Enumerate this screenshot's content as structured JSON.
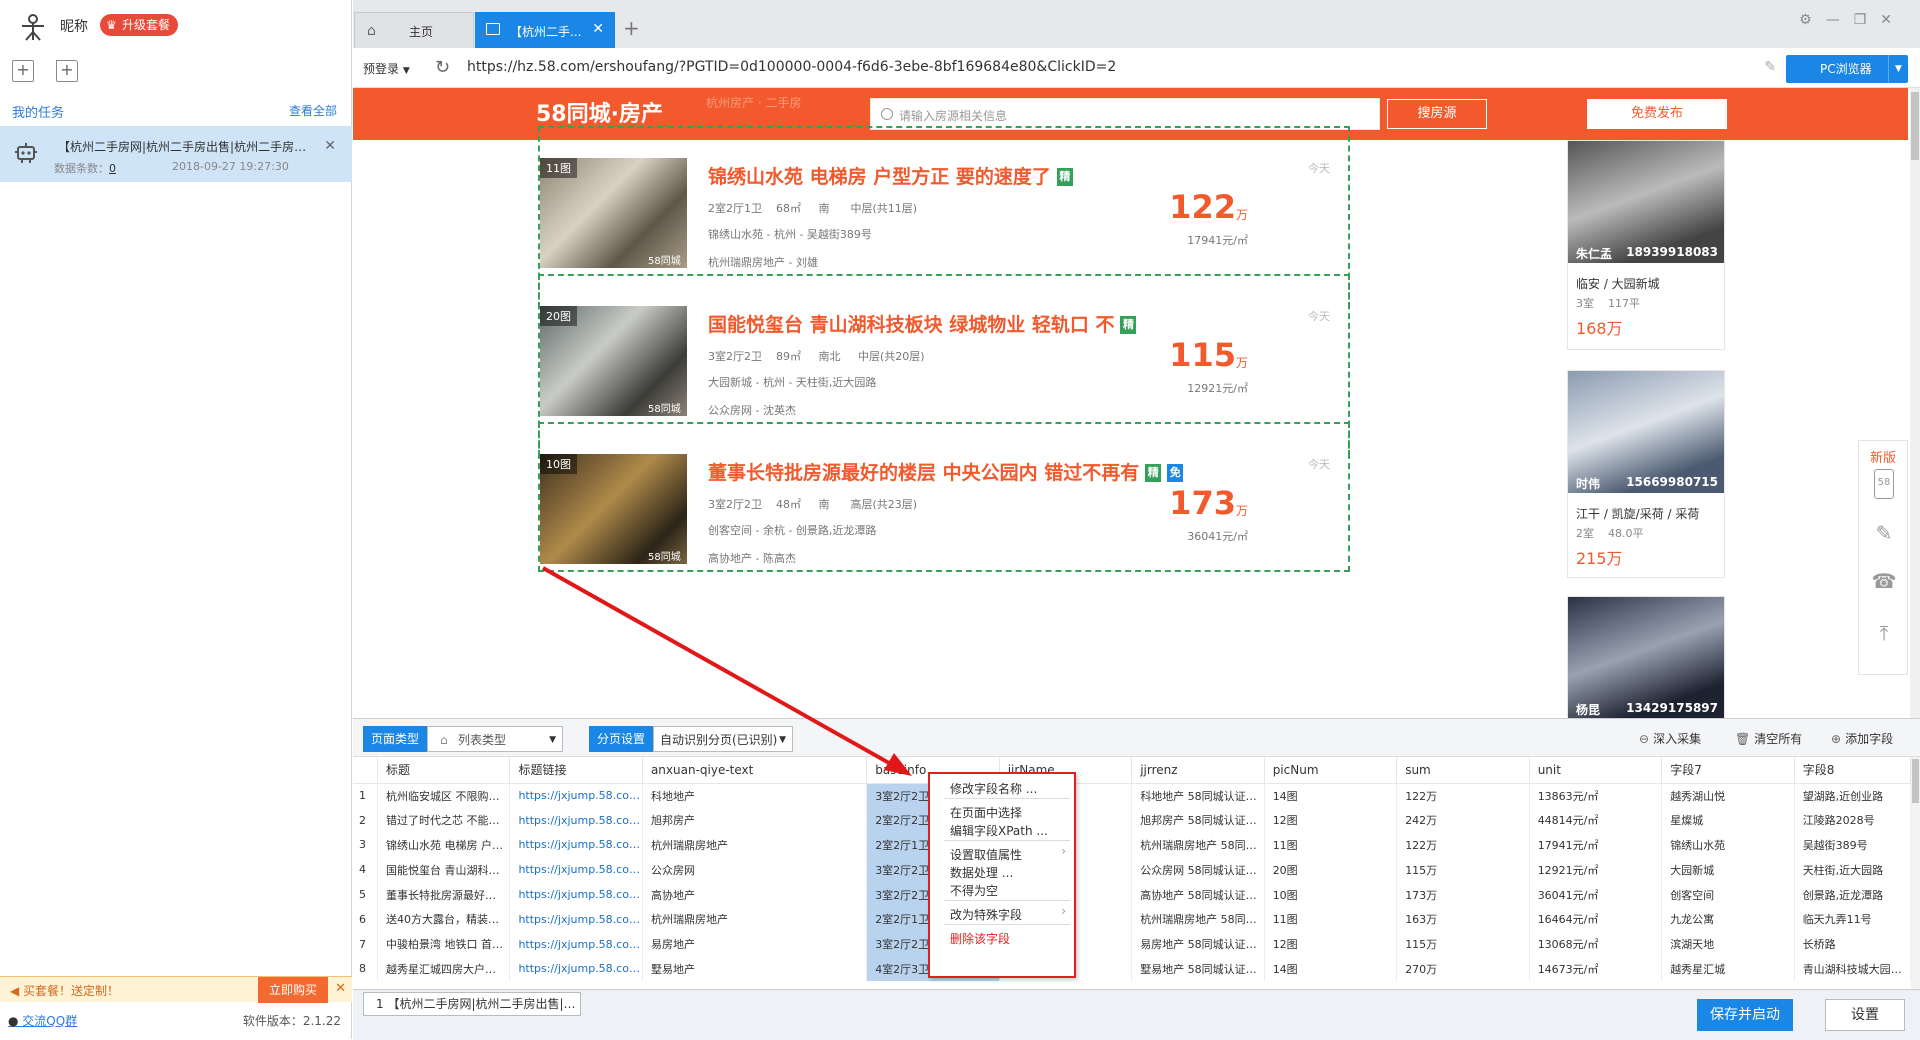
{
  "sidebar": {
    "nickname": "昵称",
    "upgrade_label": "升级套餐",
    "my_tasks_label": "我的任务",
    "view_all_label": "查看全部",
    "task": {
      "title": "【杭州二手房网|杭州二手房出售|杭州二手房…",
      "count_label": "数据条数：",
      "count_value": "0",
      "time": "2018-09-27 19:27:30"
    },
    "promo_text": "买套餐！送定制！",
    "promo_buy": "立即购买",
    "qq_group": "交流QQ群",
    "version": "软件版本：2.1.22"
  },
  "tabs": {
    "home": "主页",
    "current": "【杭州二手..."
  },
  "address": {
    "pre_login": "预登录",
    "url": "https://hz.58.com/ershoufang/?PGTID=0d100000-0004-f6d6-3ebe-8bf169684e80&ClickID=2",
    "browser_mode": "PC浏览器"
  },
  "site": {
    "logo_num": "58",
    "logo_text": "同城·房产",
    "ghost_text": "杭州房产 · 二手房",
    "search_placeholder": "请输入房源相关信息",
    "search_button": "搜房源",
    "publish_button": "免费发布"
  },
  "listings": [
    {
      "pics": "11图",
      "title": "锦绣山水苑 电梯房 户型方正 要的速度了",
      "tags": [
        "精"
      ],
      "line1": "2室2厅1卫    68㎡     南      中层(共11层)",
      "line2": "锦绣山水苑  - 杭州  - 吴越街389号",
      "line3": "杭州瑞鼎房地产 - 刘雄",
      "price": "122",
      "unit": "万",
      "per": "17941元/㎡",
      "time": "今天"
    },
    {
      "pics": "20图",
      "title": "国能悦玺台 青山湖科技板块 绿城物业 轻轨口 不",
      "tags": [
        "精"
      ],
      "line1": "3室2厅2卫    89㎡     南北     中层(共20层)",
      "line2": "大园新城  - 杭州  - 天柱街,近大园路",
      "line3": "公众房网 - 沈英杰",
      "price": "115",
      "unit": "万",
      "per": "12921元/㎡",
      "time": "今天"
    },
    {
      "pics": "10图",
      "title": "董事长特批房源最好的楼层 中央公园内 错过不再有",
      "tags": [
        "精",
        "免"
      ],
      "line1": "3室2厅2卫    48㎡     南      高层(共23层)",
      "line2": "创客空间  - 余杭  - 创景路,近龙潭路",
      "line3": "高协地产 - 陈高杰",
      "price": "173",
      "unit": "万",
      "per": "36041元/㎡",
      "time": "今天"
    }
  ],
  "side_cards": [
    {
      "agent": "朱仁孟",
      "phone": "18939918083",
      "location": "临安  / 大园新城",
      "rooms": "3室    117平",
      "price": "168万"
    },
    {
      "agent": "时伟",
      "phone": "15669980715",
      "location": "江干  / 凯旋/采荷 / 采荷",
      "rooms": "2室    48.0平",
      "price": "215万"
    },
    {
      "agent": "杨昆",
      "phone": "13429175897",
      "location": "",
      "rooms": "",
      "price": ""
    }
  ],
  "float_bar": {
    "new_label": "新版"
  },
  "collector": {
    "page_type_label": "页面类型",
    "page_type_value": "列表类型",
    "paging_label": "分页设置",
    "paging_value": "自动识别分页(已识别)",
    "deep_collect": "深入采集",
    "clear_all": "清空所有",
    "add_field": "添加字段",
    "columns": [
      "",
      "标题",
      "标题链接",
      "anxuan-qiye-text",
      "baseinfo",
      "jjrName",
      "jjrrenz",
      "picNum",
      "sum",
      "unit",
      "字段7",
      "字段8"
    ],
    "rows": [
      [
        "1",
        "杭州临安城区 不限购…",
        "https://jxjump.58.com…",
        "科地地产",
        "3室2厅2卫",
        "",
        "科地地产 58同城认证…",
        "14图",
        "122万",
        "13863元/㎡",
        "越秀湖山悦",
        "望湖路,近创业路"
      ],
      [
        "2",
        "错过了时代之芯 不能…",
        "https://jxjump.58.com…",
        "旭邦房产",
        "2室2厅2卫",
        "",
        "旭邦房产 58同城认证…",
        "12图",
        "242万",
        "44814元/㎡",
        "星燦城",
        "江陵路2028号"
      ],
      [
        "3",
        "锦绣山水苑 电梯房 户…",
        "https://jxjump.58.com…",
        "杭州瑞鼎房地产",
        "2室2厅1卫",
        "",
        "杭州瑞鼎房地产 58同…",
        "11图",
        "122万",
        "17941元/㎡",
        "锦绣山水苑",
        "吴越街389号"
      ],
      [
        "4",
        "国能悦玺台 青山湖科…",
        "https://jxjump.58.com…",
        "公众房网",
        "3室2厅2卫",
        "",
        "公众房网 58同城认证…",
        "20图",
        "115万",
        "12921元/㎡",
        "大园新城",
        "天柱街,近大园路"
      ],
      [
        "5",
        "董事长特批房源最好…",
        "https://jxjump.58.com…",
        "高协地产",
        "3室2厅2卫",
        "",
        "高协地产 58同城认证…",
        "10图",
        "173万",
        "36041元/㎡",
        "创客空间",
        "创景路,近龙潭路"
      ],
      [
        "6",
        "送40方大露台，精装…",
        "https://jxjump.58.com…",
        "杭州瑞鼎房地产",
        "2室2厅1卫",
        "",
        "杭州瑞鼎房地产 58同…",
        "11图",
        "163万",
        "16464元/㎡",
        "九龙公寓",
        "临天九弄11号"
      ],
      [
        "7",
        "中骏柏景湾 地铁口 首…",
        "https://jxjump.58.com…",
        "易房地产",
        "3室2厅2卫",
        "",
        "易房地产 58同城认证…",
        "12图",
        "115万",
        "13068元/㎡",
        "滨湖天地",
        "长桥路"
      ],
      [
        "8",
        "越秀星汇城四房大户…",
        "https://jxjump.58.com…",
        "墅易地产",
        "4室2厅3卫",
        "",
        "墅易地产 58同城认证…",
        "14图",
        "270万",
        "14673元/㎡",
        "越秀星汇城",
        "青山湖科技城大园路1…"
      ]
    ],
    "page_tab": "1 【杭州二手房网|杭州二手房出售|…",
    "save_start": "保存并启动",
    "settings": "设置"
  },
  "context_menu": {
    "rename": "修改字段名称 ...",
    "select_in_page": "在页面中选择",
    "edit_xpath": "编辑字段XPath ...",
    "set_value_attr": "设置取值属性",
    "data_process": "数据处理 ...",
    "not_empty": "不得为空",
    "special_field": "改为特殊字段",
    "delete_field": "删除该字段"
  },
  "colors": {
    "brand_blue": "#1a87e6",
    "site_orange": "#f25a2d",
    "highlight_red": "#e02020",
    "dashed_green": "#35a05a"
  }
}
